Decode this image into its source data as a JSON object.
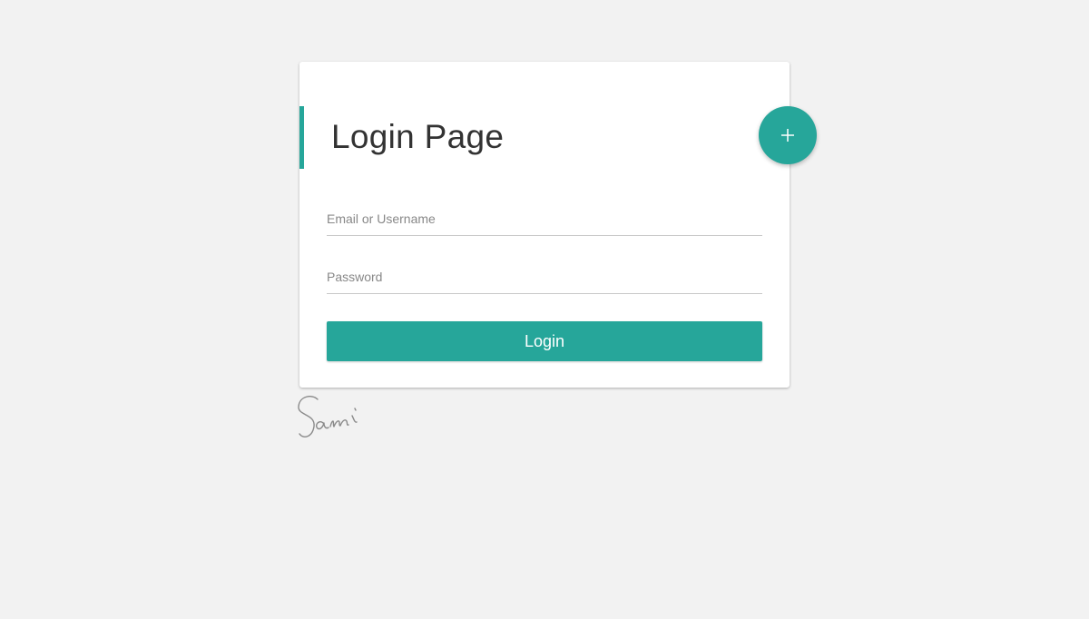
{
  "login_card": {
    "title": "Login Page",
    "add_button_label": "+",
    "email_placeholder": "Email or Username",
    "password_placeholder": "Password",
    "login_label": "Login"
  },
  "signature": {
    "text": "Sami"
  },
  "colors": {
    "accent": "#26a69a",
    "page_background": "#f2f2f2",
    "card_background": "#ffffff"
  },
  "icons": {
    "add": "plus-icon"
  }
}
